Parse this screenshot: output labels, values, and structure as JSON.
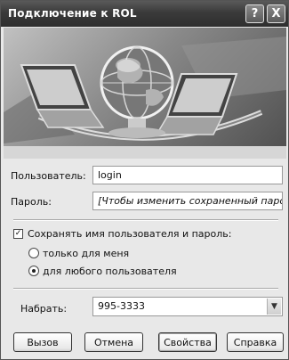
{
  "window": {
    "title": "Подключение к ROL",
    "help_label": "?",
    "close_label": "X"
  },
  "form": {
    "user_label": "Пользователь:",
    "user_value": "login",
    "password_label": "Пароль:",
    "password_value": "[Чтобы изменить сохраненный пароль, ще.",
    "save_label": "Сохранять имя пользователя и пароль:",
    "save_checked": true,
    "only_me_label": "только для меня",
    "any_user_label": "для любого пользователя",
    "selected_option": "any_user",
    "dial_label": "Набрать:",
    "dial_value": "995-3333"
  },
  "buttons": {
    "call": "Вызов",
    "cancel": "Отмена",
    "properties": "Свойства",
    "help": "Справка"
  },
  "icons": [
    "globe-icon",
    "laptop-icon",
    "checkbox-icon",
    "radio-icon",
    "dropdown-arrow-icon"
  ]
}
